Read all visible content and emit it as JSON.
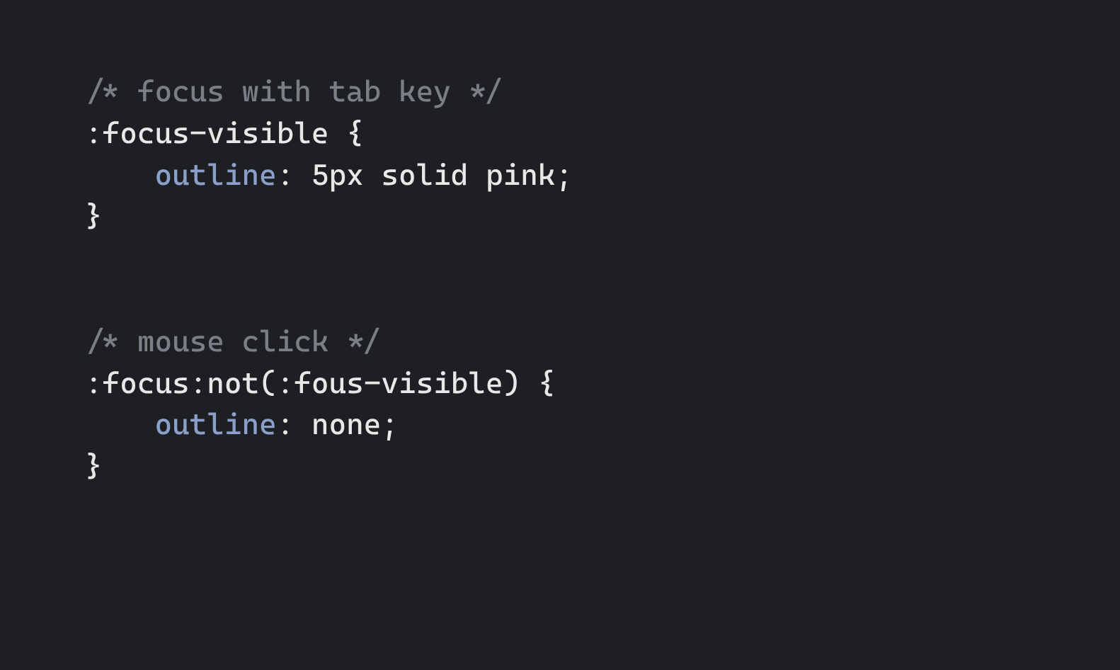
{
  "code": {
    "block1": {
      "comment": "/* focus with tab key */",
      "selector": ":focus-visible",
      "brace_open": " {",
      "property": "outline",
      "colon": ": ",
      "value": "5px solid pink",
      "semicolon": ";",
      "brace_close": "}"
    },
    "block2": {
      "comment": "/* mouse click */",
      "selector": ":focus:not(:fous-visible)",
      "brace_open": " {",
      "property": "outline",
      "colon": ": ",
      "value": "none",
      "semicolon": ";",
      "brace_close": "}"
    }
  }
}
